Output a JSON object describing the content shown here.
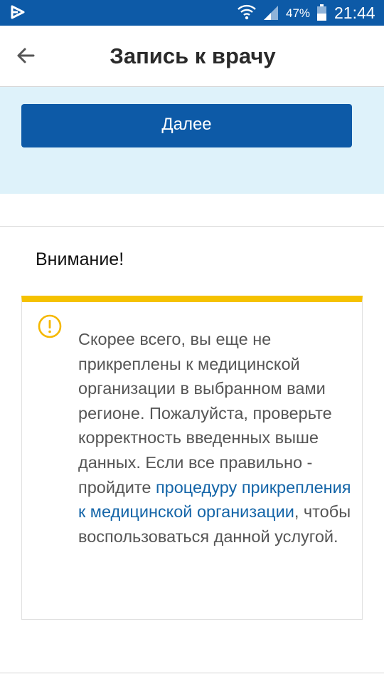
{
  "status_bar": {
    "battery": "47%",
    "time": "21:44",
    "icons": [
      "app-notification-icon",
      "wifi-icon",
      "signal-icon",
      "battery-icon"
    ]
  },
  "header": {
    "title": "Запись к врачу",
    "back_icon": "arrow-left-icon"
  },
  "actions": {
    "next_label": "Далее"
  },
  "notice": {
    "heading": "Внимание!",
    "icon": "exclamation-circle-icon",
    "text_before": "Скорее всего, вы еще не прикреплены к медицинской организации в выбранном вами регионе. Пожалуйста, проверьте корректность введенных выше данных. Если все правильно - пройдите ",
    "link_text": "процедуру прикрепления к медицинской организации",
    "text_after": ", чтобы воспользоваться данной услугой."
  },
  "colors": {
    "brand_blue": "#0d5aa7",
    "section_background": "#def2fa",
    "warning_yellow": "#f5c200",
    "link": "#1465a8"
  }
}
